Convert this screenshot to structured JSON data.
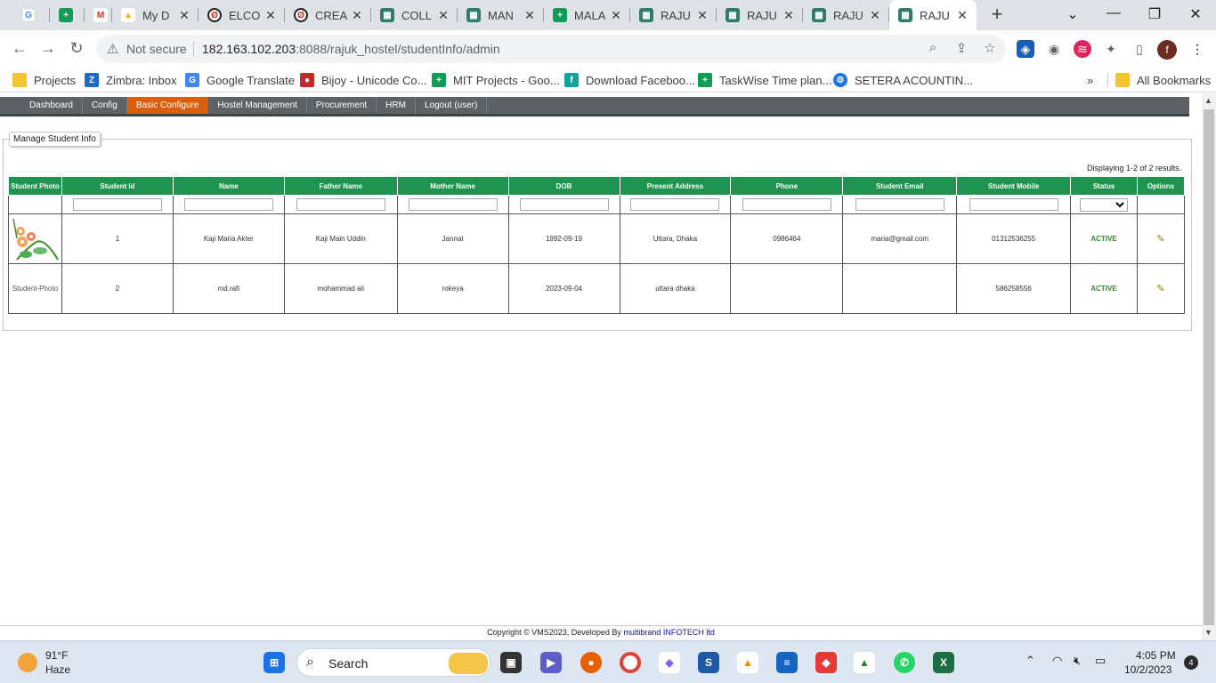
{
  "browser": {
    "tabs": [
      {
        "title": "",
        "icon": "google-translate-icon",
        "fav": "G"
      },
      {
        "title": "",
        "icon": "google-sheets-icon",
        "fav": "+"
      },
      {
        "title": "",
        "icon": "gmail-icon",
        "fav": "M"
      },
      {
        "title": "My D",
        "icon": "google-drive-icon",
        "fav": "▲"
      },
      {
        "title": "ELCO",
        "icon": "circle-app-icon",
        "fav": "Ø"
      },
      {
        "title": "CREA",
        "icon": "circle-app-icon",
        "fav": "Ø"
      },
      {
        "title": "COLL",
        "icon": "app-page-icon",
        "fav": "▦"
      },
      {
        "title": "MAN",
        "icon": "app-page-icon",
        "fav": "▦"
      },
      {
        "title": "MALA",
        "icon": "google-sheets-icon",
        "fav": "+"
      },
      {
        "title": "RAJU",
        "icon": "app-page-icon",
        "fav": "▦"
      },
      {
        "title": "RAJU",
        "icon": "app-page-icon",
        "fav": "▦"
      },
      {
        "title": "RAJU",
        "icon": "app-page-icon",
        "fav": "▦"
      },
      {
        "title": "RAJU",
        "icon": "app-page-icon",
        "fav": "▦"
      }
    ],
    "security_label": "Not secure",
    "url_host": "182.163.102.203",
    "url_rest": ":8088/rajuk_hostel/studentInfo/admin",
    "profile_initial": "f",
    "bookmarks": [
      {
        "label": "Projects",
        "icon": "folder-icon"
      },
      {
        "label": "Zimbra: Inbox",
        "icon": "zimbra-icon"
      },
      {
        "label": "Google Translate",
        "icon": "google-translate-icon"
      },
      {
        "label": "Bijoy - Unicode Co...",
        "icon": "bijoy-icon"
      },
      {
        "label": "MIT Projects - Goo...",
        "icon": "google-sheets-icon"
      },
      {
        "label": "Download Faceboo...",
        "icon": "facebook-icon"
      },
      {
        "label": "TaskWise Time plan...",
        "icon": "google-sheets-icon"
      },
      {
        "label": "SETERA ACOUNTIN...",
        "icon": "gear-icon"
      }
    ],
    "bookmarks_more": "»",
    "all_bookmarks": "All Bookmarks"
  },
  "app": {
    "menu": [
      {
        "label": "Dashboard",
        "selected": false
      },
      {
        "label": "Config",
        "selected": false
      },
      {
        "label": "Basic Configure",
        "selected": true
      },
      {
        "label": "Hostel Management",
        "selected": false
      },
      {
        "label": "Procurement",
        "selected": false
      },
      {
        "label": "HRM",
        "selected": false
      },
      {
        "label": "Logout (user)",
        "selected": false
      }
    ],
    "panel_title": "Manage Student Info",
    "summary": "Displaying 1-2 of 2 results.",
    "columns": [
      "Student Photo",
      "Student Id",
      "Name",
      "Father Name",
      "Mother Name",
      "DOB",
      "Present Address",
      "Phone",
      "Student Email",
      "Student Mobile",
      "Status",
      "Options"
    ],
    "rows": [
      {
        "photo": "",
        "id": "1",
        "name": "Kaji Maria Akter",
        "father": "Kaji Main Uddin",
        "mother": "Jannat",
        "dob": "1992-09-19",
        "address": "Uttara, Dhaka",
        "phone": "0986464",
        "email": "maria@gmail.com",
        "mobile": "01312536255",
        "status": "ACTIVE"
      },
      {
        "photo": "Student-Photo",
        "id": "2",
        "name": "md.rafi",
        "father": "mohammad ali",
        "mother": "rokeya",
        "dob": "2023-09-04",
        "address": "uttara dhaka",
        "phone": "",
        "email": "",
        "mobile": "586258556",
        "status": "ACTIVE"
      }
    ],
    "footer_prefix": "Copyright © VMS2023, Developed By ",
    "footer_link": "multibrand INFOTECH ltd"
  },
  "taskbar": {
    "temperature": "91°F",
    "condition": "Haze",
    "search_label": "Search",
    "time": "4:05 PM",
    "date": "10/2/2023",
    "notifications": "4"
  },
  "colors": {
    "menu_bg": "#5d6266",
    "menu_selected": "#d95f0e",
    "table_header": "#1f9450",
    "status_active": "#2f8a28"
  }
}
